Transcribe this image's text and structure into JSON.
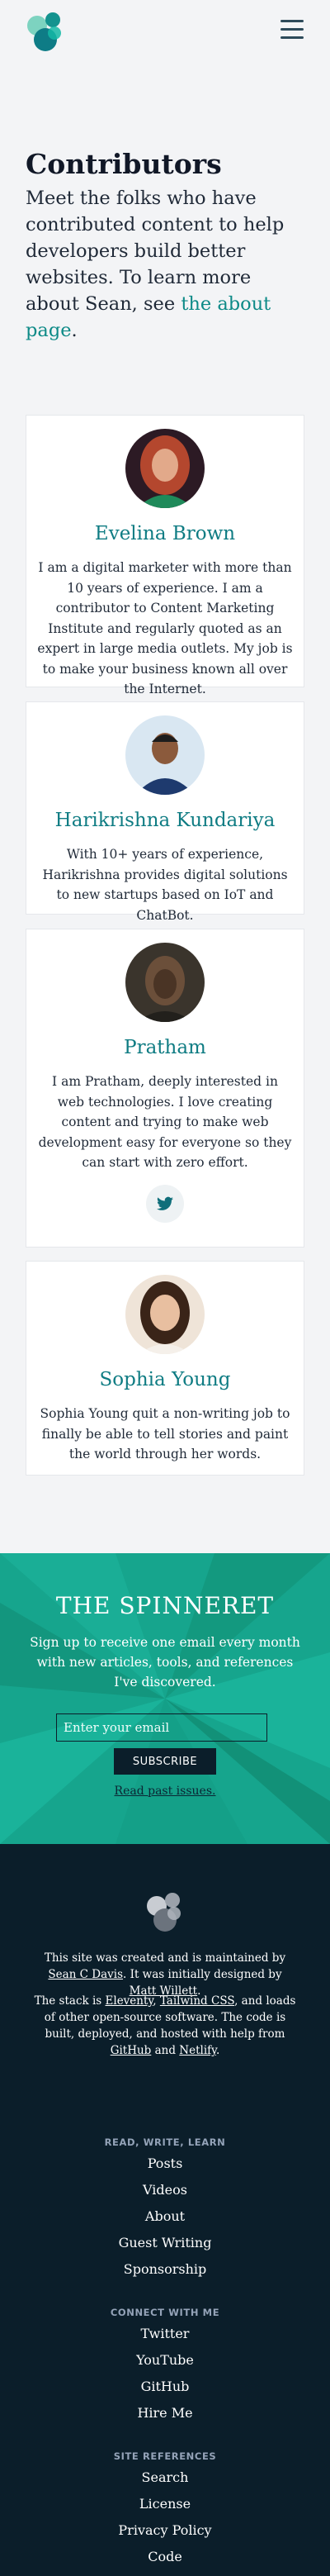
{
  "colors": {
    "accent": "#0f7c83",
    "link": "#0d8a87",
    "newsletter_bg": "#16a58d",
    "footer_bg": "#0b1e2a",
    "page_bg": "#f3f4f6"
  },
  "header": {
    "logo_icon": "stacked-circles-logo-icon",
    "menu_icon": "hamburger-menu-icon"
  },
  "hero": {
    "title": "Contributors",
    "intro": "Meet the folks who have contributed content to help developers build better websites. To learn more about Sean, see ",
    "intro_link": "the about page",
    "intro_end": "."
  },
  "contributors": [
    {
      "name": "Evelina Brown",
      "bio": "I am a digital marketer with more than 10 years of experience. I am a contributor to Content Marketing Institute and regularly quoted as an expert in large media outlets. My job is to make your business known all over the Internet."
    },
    {
      "name": "Harikrishna Kundariya",
      "bio": "With 10+ years of experience, Harikrishna provides digital solutions to new startups based on IoT and ChatBot."
    },
    {
      "name": "Pratham",
      "bio": "I am Pratham, deeply interested in web technologies. I love creating content and trying to make web development easy for everyone so they can start with zero effort.",
      "social_icon": "twitter-icon"
    },
    {
      "name": "Sophia Young",
      "bio": "Sophia Young quit a non-writing job to finally be able to tell stories and paint the world through her words."
    }
  ],
  "newsletter": {
    "title": "THE SPINNERET",
    "text": "Sign up to receive one email every month with new articles, tools, and references I've discovered.",
    "placeholder": "Enter your email",
    "button": "SUBSCRIBE",
    "past_link": "Read past issues."
  },
  "footer": {
    "p1": {
      "t1": "This site was created and is maintained by ",
      "l1": "Sean C Davis",
      "t2": ". It was initially designed by ",
      "l2": "Matt Willett",
      "t3": "."
    },
    "p2": {
      "t1": "The stack is ",
      "l1": "Eleventy",
      "t2": ", ",
      "l2": "Tailwind CSS",
      "t3": ", and loads of other open-source software. The code is built, deployed, and hosted with help from ",
      "l3": "GitHub",
      "t4": " and ",
      "l4": "Netlify",
      "t5": "."
    },
    "sections": [
      {
        "heading": "READ, WRITE, LEARN",
        "links": [
          "Posts",
          "Videos",
          "About",
          "Guest Writing",
          "Sponsorship"
        ]
      },
      {
        "heading": "CONNECT WITH ME",
        "links": [
          "Twitter",
          "YouTube",
          "GitHub",
          "Hire Me"
        ]
      },
      {
        "heading": "SITE REFERENCES",
        "links": [
          "Search",
          "License",
          "Privacy Policy",
          "Code"
        ]
      }
    ]
  }
}
